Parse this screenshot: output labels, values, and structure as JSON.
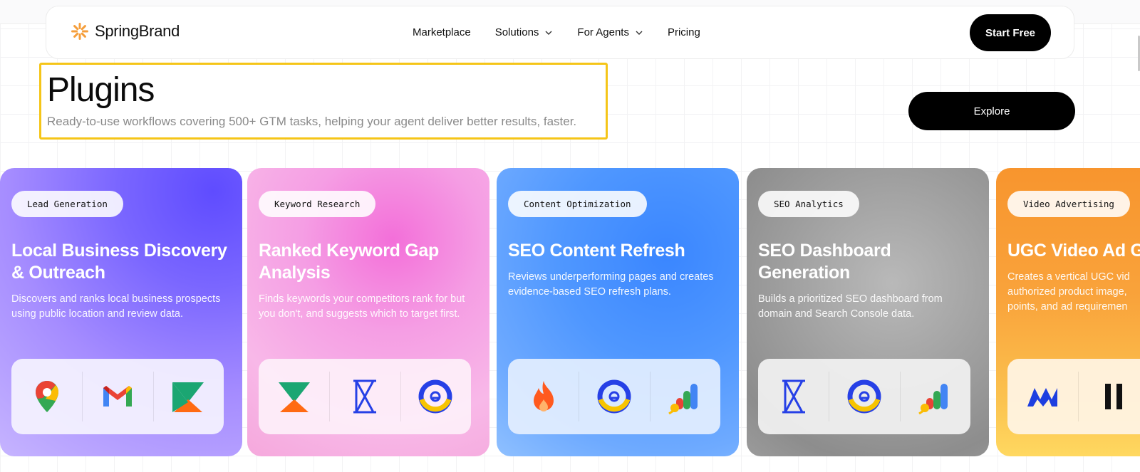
{
  "brand": {
    "name": "SpringBrand",
    "accent": "#f59e3b"
  },
  "nav": {
    "links": [
      {
        "label": "Marketplace",
        "has_dropdown": false
      },
      {
        "label": "Solutions",
        "has_dropdown": true
      },
      {
        "label": "For Agents",
        "has_dropdown": true
      },
      {
        "label": "Pricing",
        "has_dropdown": false
      }
    ],
    "cta_label": "Start Free"
  },
  "hero": {
    "title": "Plugins",
    "subtitle": "Ready-to-use workflows covering 500+ GTM tasks, helping your agent deliver better results, faster.",
    "explore_label": "Explore",
    "highlight_color": "#f5c518"
  },
  "cards": [
    {
      "tag": "Lead Generation",
      "title": "Local Business Discovery & Outreach",
      "description": "Discovers and ranks local business prospects using public location and review data.",
      "icons": [
        "google-maps-icon",
        "gmail-icon",
        "apollo-icon"
      ],
      "color": "#6f5cff"
    },
    {
      "tag": "Keyword Research",
      "title": "Ranked Keyword Gap Analysis",
      "description": "Finds keywords your competitors rank for but you don't, and suggests which to target first.",
      "icons": [
        "apollo-icon",
        "hourglass-icon",
        "search-lens-icon"
      ],
      "color": "#f36fd9"
    },
    {
      "tag": "Content Optimization",
      "title": "SEO Content Refresh",
      "description": "Reviews underperforming pages and creates evidence-based SEO refresh plans.",
      "icons": [
        "firecrawl-icon",
        "search-lens-icon",
        "analytics-icon"
      ],
      "color": "#3a86ff"
    },
    {
      "tag": "SEO Analytics",
      "title": "SEO Dashboard Generation",
      "description": "Builds a prioritized SEO dashboard from domain and Search Console data.",
      "icons": [
        "hourglass-icon",
        "search-lens-icon",
        "analytics-icon"
      ],
      "color": "#9a9a9a"
    },
    {
      "tag": "Video Advertising",
      "title": "UGC Video Ad G",
      "description": "Creates a vertical UGC vid authorized product image, points, and ad requiremen",
      "icons": [
        "zigzag-m-icon",
        "pause-bars-icon"
      ],
      "color": "#f8952e"
    }
  ]
}
